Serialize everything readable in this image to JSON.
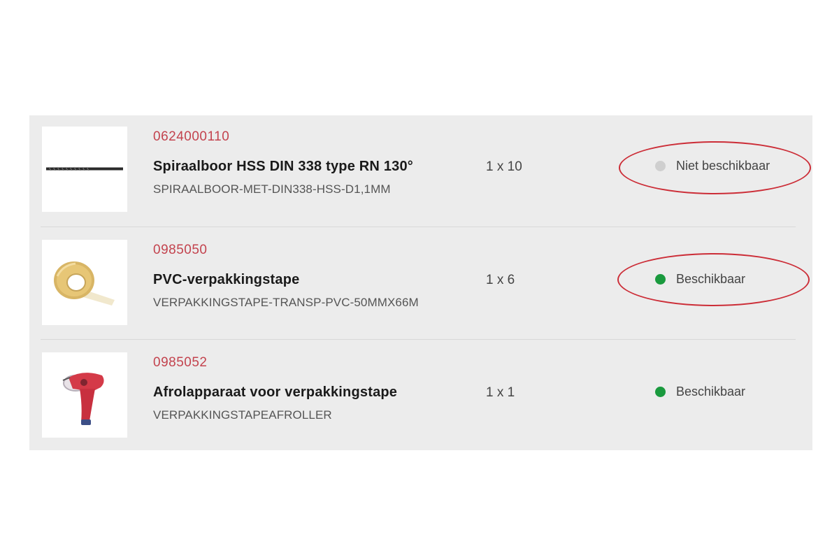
{
  "colors": {
    "code_red": "#c3434e",
    "unavailable_dot": "#cfcfcf",
    "available_dot": "#1a9a3e",
    "highlight_oval": "#cc2d37"
  },
  "products": [
    {
      "code": "0624000110",
      "name": "Spiraalboor HSS DIN 338 type RN 130°",
      "variant": "SPIRAALBOOR-MET-DIN338-HSS-D1,1MM",
      "quantity": "1 x 10",
      "status": "Niet beschikbaar",
      "status_color": "#cfcfcf",
      "highlighted": true,
      "image_icon": "drill-bit-icon"
    },
    {
      "code": "0985050",
      "name": "PVC-verpakkingstape",
      "variant": "VERPAKKINGSTAPE-TRANSP-PVC-50MMX66M",
      "quantity": "1 x 6",
      "status": "Beschikbaar",
      "status_color": "#1a9a3e",
      "highlighted": true,
      "image_icon": "tape-roll-icon"
    },
    {
      "code": "0985052",
      "name": "Afrolapparaat voor verpakkingstape",
      "variant": "VERPAKKINGSTAPEAFROLLER",
      "quantity": "1 x 1",
      "status": "Beschikbaar",
      "status_color": "#1a9a3e",
      "highlighted": false,
      "image_icon": "tape-dispenser-icon"
    }
  ]
}
